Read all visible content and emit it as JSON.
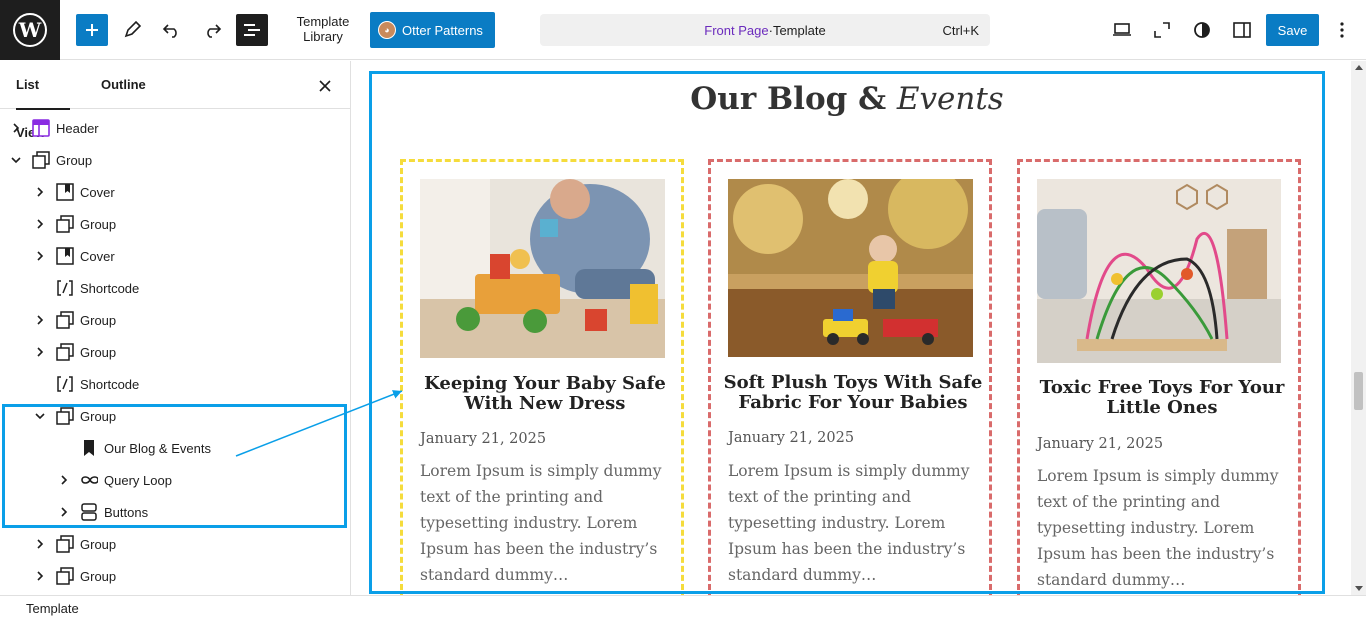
{
  "topbar": {
    "template_library": [
      "Template",
      "Library"
    ],
    "otter_patterns": "Otter Patterns",
    "command": {
      "link": "Front Page",
      "sep": " · ",
      "rest": "Template",
      "shortcut": "Ctrl+K"
    },
    "save_label": "Save"
  },
  "sidebar": {
    "tabs": [
      "List View",
      "Outline"
    ],
    "tree": [
      {
        "label": "Header",
        "icon": "header-icon",
        "level": 0,
        "chevron": "right"
      },
      {
        "label": "Group",
        "icon": "group-icon",
        "level": 0,
        "chevron": "down"
      },
      {
        "label": "Cover",
        "icon": "cover-icon",
        "level": 1,
        "chevron": "right"
      },
      {
        "label": "Group",
        "icon": "group-icon",
        "level": 1,
        "chevron": "right"
      },
      {
        "label": "Cover",
        "icon": "cover-icon",
        "level": 1,
        "chevron": "right"
      },
      {
        "label": "Shortcode",
        "icon": "shortcode-icon",
        "level": 1,
        "chevron": "none"
      },
      {
        "label": "Group",
        "icon": "group-icon",
        "level": 1,
        "chevron": "right"
      },
      {
        "label": "Group",
        "icon": "group-icon",
        "level": 1,
        "chevron": "right"
      },
      {
        "label": "Shortcode",
        "icon": "shortcode-icon",
        "level": 1,
        "chevron": "none"
      },
      {
        "label": "Group",
        "icon": "group-icon",
        "level": 1,
        "chevron": "down"
      },
      {
        "label": "Our Blog & Events",
        "icon": "bookmark-icon",
        "level": 2,
        "chevron": "none"
      },
      {
        "label": "Query Loop",
        "icon": "loop-icon",
        "level": 2,
        "chevron": "right"
      },
      {
        "label": "Buttons",
        "icon": "buttons-icon",
        "level": 2,
        "chevron": "right"
      },
      {
        "label": "Group",
        "icon": "group-icon",
        "level": 1,
        "chevron": "right"
      },
      {
        "label": "Group",
        "icon": "group-icon",
        "level": 1,
        "chevron": "right"
      }
    ]
  },
  "canvas": {
    "heading_plain": "Our Blog & ",
    "heading_italic": "Events",
    "posts": [
      {
        "title": "Keeping Your Baby Safe With New Dress",
        "date": "January 21, 2025",
        "excerpt": "Lorem Ipsum is simply dummy text of the printing and typesetting industry. Lorem Ipsum has been the industry’s standard dummy…"
      },
      {
        "title": "Soft Plush Toys With Safe Fabric For Your Babies",
        "date": "January 21, 2025",
        "excerpt": "Lorem Ipsum is simply dummy text of the printing and typesetting industry. Lorem Ipsum has been the industry’s standard dummy…"
      },
      {
        "title": "Toxic Free Toys For Your Little Ones",
        "date": "January 21, 2025",
        "excerpt": "Lorem Ipsum is simply dummy text of the printing and typesetting industry. Lorem Ipsum has been the industry’s standard dummy…"
      }
    ]
  },
  "statusbar": {
    "label": "Template"
  },
  "colors": {
    "accent": "#0a7cc4",
    "highlight": "#0a9fe8",
    "purple": "#6b2bbd"
  }
}
